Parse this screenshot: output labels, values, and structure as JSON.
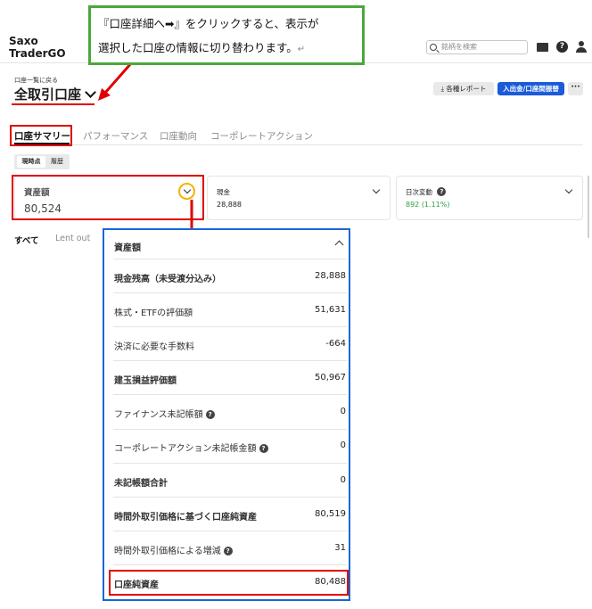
{
  "header": {
    "logo_line1": "Saxo",
    "logo_line2": "TraderGO",
    "search_placeholder": "銘柄を検索",
    "help_glyph": "?"
  },
  "account": {
    "back_link": "口座一覧に戻る",
    "name": "全取引口座",
    "report_button": "⤓ 各種レポート",
    "deposit_button": "入出金/口座間振替",
    "more_button": "···"
  },
  "tabs": [
    "口座サマリー",
    "パフォーマンス",
    "口座動向",
    "コーポレートアクション"
  ],
  "segment": [
    "現時点",
    "履歴"
  ],
  "cards": [
    {
      "label": "資産額",
      "value": "80,524"
    },
    {
      "label": "現金",
      "value": "28,888"
    },
    {
      "label": "日次変動",
      "value": "892 (1.11%)"
    }
  ],
  "subtabs": [
    "すべて",
    "Lent out"
  ],
  "callout": {
    "line1": "『口座詳細へ➡』をクリックすると、表示が",
    "line2": "選択した口座の情報に切り替わります。",
    "enter_mark": "↵"
  },
  "colors": {
    "accent_blue": "#1a5bd8",
    "highlight_red": "#e00000",
    "callout_green": "#4aa83b",
    "ring_yellow": "#f4b400",
    "positive_green": "#2e9e44"
  },
  "panel": {
    "title": "資産額",
    "rows": [
      {
        "label": "現金残高（未受渡分込み）",
        "value": "28,888",
        "bold": true
      },
      {
        "label": "株式・ETFの評価額",
        "value": "51,631",
        "bold": false
      },
      {
        "label": "決済に必要な手数料",
        "value": "-664",
        "bold": false
      },
      {
        "label": "建玉損益評価額",
        "value": "50,967",
        "bold": true
      },
      {
        "label": "ファイナンス未記帳額",
        "value": "0",
        "bold": false
      },
      {
        "label": "コーポレートアクション未記帳金額",
        "value": "0",
        "bold": false
      },
      {
        "label": "未記帳額合計",
        "value": "0",
        "bold": true
      },
      {
        "label": "時間外取引価格に基づく口座純資産",
        "value": "80,519",
        "bold": true
      },
      {
        "label": "時間外取引価格による増減",
        "value": "31",
        "bold": false
      },
      {
        "label": "口座純資産",
        "value": "80,488",
        "bold": true
      }
    ]
  }
}
